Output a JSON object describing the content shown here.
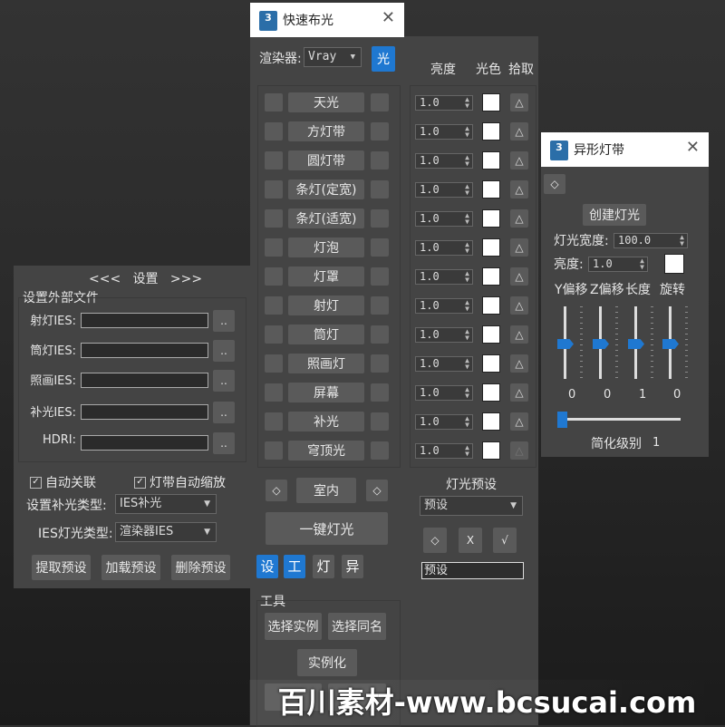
{
  "main": {
    "title": "快速布光",
    "logo": "3",
    "renderer_label": "渲染器:",
    "renderer_value": "Vray",
    "light_button": "光",
    "col_brightness": "亮度",
    "col_color": "光色",
    "col_pick": "拾取",
    "lights": [
      {
        "name": "天光",
        "value": "1.0"
      },
      {
        "name": "方灯带",
        "value": "1.0"
      },
      {
        "name": "圆灯带",
        "value": "1.0"
      },
      {
        "name": "条灯(定宽)",
        "value": "1.0"
      },
      {
        "name": "条灯(适宽)",
        "value": "1.0"
      },
      {
        "name": "灯泡",
        "value": "1.0"
      },
      {
        "name": "灯罩",
        "value": "1.0"
      },
      {
        "name": "射灯",
        "value": "1.0"
      },
      {
        "name": "筒灯",
        "value": "1.0"
      },
      {
        "name": "照画灯",
        "value": "1.0"
      },
      {
        "name": "屏幕",
        "value": "1.0"
      },
      {
        "name": "补光",
        "value": "1.0"
      },
      {
        "name": "穹顶光",
        "value": "1.0"
      }
    ],
    "pick_glyph": "△",
    "indoor_button": "室内",
    "one_click_button": "一键灯光",
    "diamond_glyph": "◇",
    "tabs": [
      "设",
      "工",
      "灯",
      "异"
    ],
    "preset_title": "灯光预设",
    "preset_value": "预设",
    "preset_x": "X",
    "preset_check": "√",
    "preset_input_value": "预设",
    "tools_title": "工具",
    "select_instance": "选择实例",
    "select_same_name": "选择同名",
    "instantiate": "实例化"
  },
  "settings": {
    "header": "<<<   设置   >>>",
    "external_files": "设置外部文件",
    "rows": [
      {
        "label": "射灯IES:"
      },
      {
        "label": "筒灯IES:"
      },
      {
        "label": "照画IES:"
      },
      {
        "label": "补光IES:"
      },
      {
        "label": "HDRI:"
      }
    ],
    "browse": "..",
    "auto_link": "自动关联",
    "auto_scale": "灯带自动缩放",
    "fill_type_label": "设置补光类型:",
    "fill_type_value": "IES补光",
    "ies_type_label": "IES灯光类型:",
    "ies_type_value": "渲染器IES",
    "extract_preset": "提取预设",
    "load_preset": "加载预设",
    "delete_preset": "删除预设"
  },
  "shaped": {
    "title": "异形灯带",
    "logo": "3",
    "create": "创建灯光",
    "width_label": "灯光宽度:",
    "width_value": "100.0",
    "brightness_label": "亮度:",
    "brightness_value": "1.0",
    "col_labels": [
      "Y偏移",
      "Z偏移",
      "长度",
      "旋转"
    ],
    "slider_values": [
      "0",
      "0",
      "1",
      "0"
    ],
    "simplify_label": "简化级别",
    "simplify_value": "1"
  },
  "watermark": "百川素材-www.bcsucai.com",
  "colors": {
    "accent": "#1f78d1",
    "panel": "#444444",
    "button": "#5a5a5a"
  }
}
